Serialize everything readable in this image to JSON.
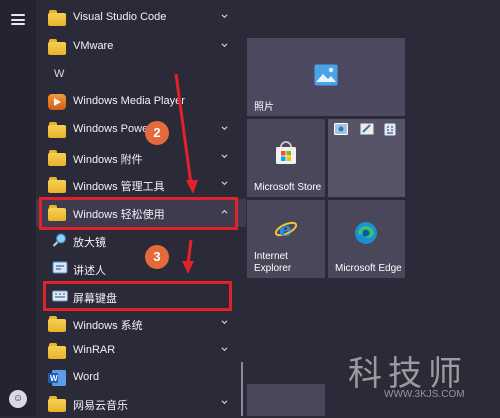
{
  "left_rail": {
    "hamburger": "menu",
    "user": "user"
  },
  "apps": {
    "section_letter": "W",
    "items": [
      {
        "label": "Visual Studio Code",
        "icon": "folder-icon",
        "chevron": "down"
      },
      {
        "label": "VMware",
        "icon": "folder-icon",
        "chevron": "down"
      },
      {
        "label": "Windows Media Player",
        "icon": "media-player-icon",
        "chevron": ""
      },
      {
        "label": "Windows Power",
        "icon": "folder-icon",
        "chevron": "down"
      },
      {
        "label": "Windows 附件",
        "icon": "folder-icon",
        "chevron": "down"
      },
      {
        "label": "Windows 管理工具",
        "icon": "folder-icon",
        "chevron": "down"
      },
      {
        "label": "Windows 轻松使用",
        "icon": "folder-icon",
        "chevron": "up"
      },
      {
        "label": "放大镜",
        "icon": "magnifier-icon",
        "chevron": ""
      },
      {
        "label": "讲述人",
        "icon": "narrator-icon",
        "chevron": ""
      },
      {
        "label": "屏幕键盘",
        "icon": "keyboard-icon",
        "chevron": ""
      },
      {
        "label": "Windows 系统",
        "icon": "folder-icon",
        "chevron": "down"
      },
      {
        "label": "WinRAR",
        "icon": "folder-icon",
        "chevron": "down"
      },
      {
        "label": "Word",
        "icon": "word-icon",
        "chevron": ""
      },
      {
        "label": "网易云音乐",
        "icon": "folder-icon",
        "chevron": "down"
      }
    ]
  },
  "tiles": {
    "photos": "照片",
    "store": "Microsoft Store",
    "ie": "Internet Explorer",
    "edge": "Microsoft Edge"
  },
  "annotations": {
    "badge_2": "2",
    "badge_3": "3"
  },
  "watermark": {
    "text": "科技师",
    "url": "WWW.3KJS.COM"
  },
  "colors": {
    "accent_red": "#e2222a",
    "badge": "#e26a3b",
    "background": "#2a2a38"
  }
}
